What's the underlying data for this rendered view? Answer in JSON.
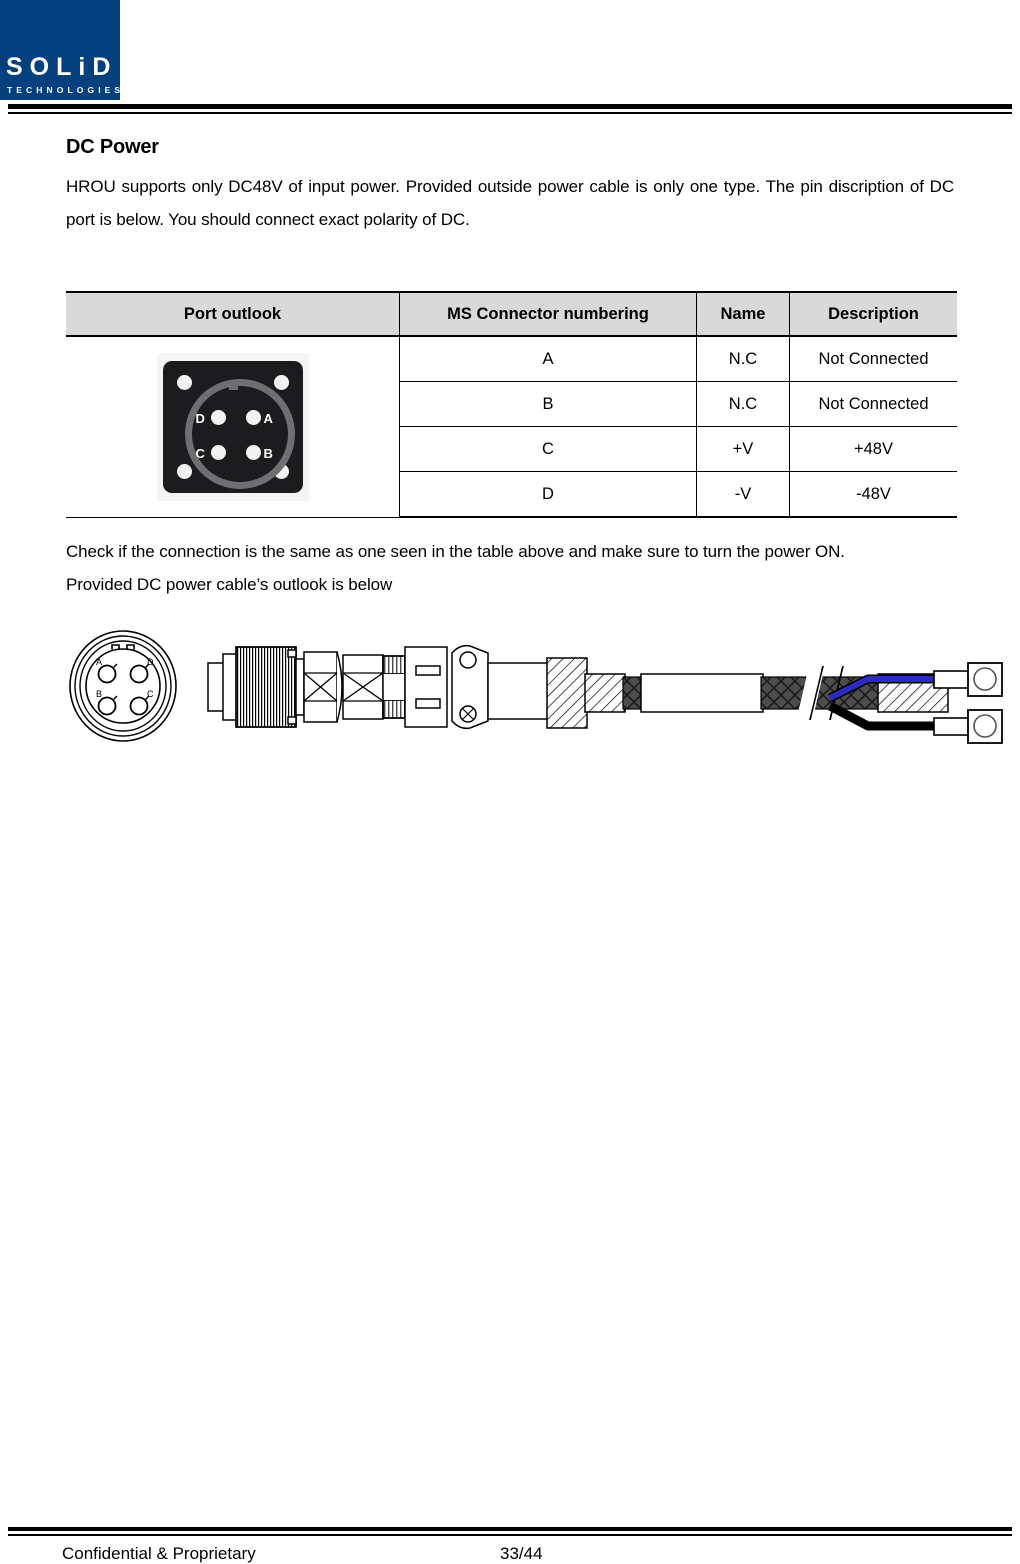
{
  "header": {
    "logo_primary": "SOLiD",
    "logo_secondary": "TECHNOLOGIES",
    "brand_color": "#04407e"
  },
  "section": {
    "title": "DC Power",
    "paragraph_1": "HROU supports only DC48V of input power. Provided outside power cable is only one type. The pin discription of DC port is below. You should connect exact polarity of DC.",
    "paragraph_2": "Check if the connection is the same as one seen in the table above and make sure to turn the power ON.",
    "paragraph_3": "Provided DC power cable’s outlook is below"
  },
  "table": {
    "headers": [
      "Port outlook",
      "MS Connector numbering",
      "Name",
      "Description"
    ],
    "header_bg": "#d9d9d9",
    "rows": [
      {
        "ms": "A",
        "name": "N.C",
        "description": "Not Connected"
      },
      {
        "ms": "B",
        "name": "N.C",
        "description": "Not Connected"
      },
      {
        "ms": "C",
        "name": "+V",
        "description": "+48V"
      },
      {
        "ms": "D",
        "name": "-V",
        "description": "-48V"
      }
    ],
    "port_image": {
      "alt": "MS connector port front view",
      "pin_labels": {
        "top_left": "D",
        "top_right": "A",
        "bottom_left": "C",
        "bottom_right": "B"
      }
    }
  },
  "cable_diagram": {
    "alt": "DC power cable outlook drawing",
    "connector_face_pins": {
      "top_left": "A",
      "top_right": "D",
      "bottom_left": "B",
      "bottom_right": "C"
    },
    "wire_colors": {
      "positive": "#2b2bbf",
      "negative": "#000000"
    }
  },
  "footer": {
    "confidential": "Confidential & Proprietary",
    "page": "33/44"
  }
}
